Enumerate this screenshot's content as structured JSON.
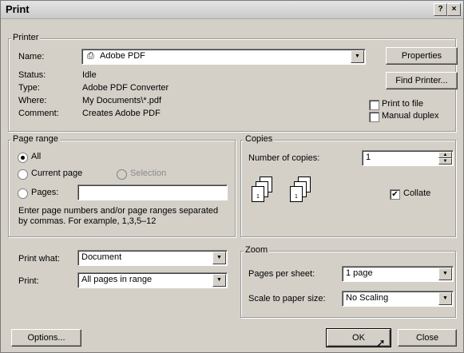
{
  "window": {
    "title": "Print",
    "help_label": "?",
    "close_label": "×"
  },
  "printer": {
    "legend": "Printer",
    "name_label": "Name:",
    "name_value": "Adobe PDF",
    "status_label": "Status:",
    "status_value": "Idle",
    "type_label": "Type:",
    "type_value": "Adobe PDF Converter",
    "where_label": "Where:",
    "where_value": "My Documents\\*.pdf",
    "comment_label": "Comment:",
    "comment_value": "Creates Adobe PDF",
    "properties_button": "Properties",
    "find_printer_button": "Find Printer...",
    "print_to_file_label": "Print to file",
    "print_to_file_checked": false,
    "manual_duplex_label": "Manual duplex",
    "manual_duplex_checked": false
  },
  "page_range": {
    "legend": "Page range",
    "all_label": "All",
    "current_page_label": "Current page",
    "selection_label": "Selection",
    "pages_label": "Pages:",
    "pages_value": "",
    "selected": "All",
    "hint": "Enter page numbers and/or page ranges separated by commas.  For example, 1,3,5–12"
  },
  "copies": {
    "legend": "Copies",
    "number_label": "Number of copies:",
    "number_value": "1",
    "collate_label": "Collate",
    "collate_checked": true,
    "stack_a": [
      "3",
      "2",
      "1"
    ],
    "stack_b": [
      "3",
      "2",
      "1"
    ]
  },
  "print_what": {
    "label": "Print what:",
    "value": "Document"
  },
  "print_range": {
    "label": "Print:",
    "value": "All pages in range"
  },
  "zoom": {
    "legend": "Zoom",
    "pages_per_sheet_label": "Pages per sheet:",
    "pages_per_sheet_value": "1 page",
    "scale_label": "Scale to paper size:",
    "scale_value": "No Scaling"
  },
  "footer": {
    "options_button": "Options...",
    "ok_button": "OK",
    "close_button": "Close"
  }
}
